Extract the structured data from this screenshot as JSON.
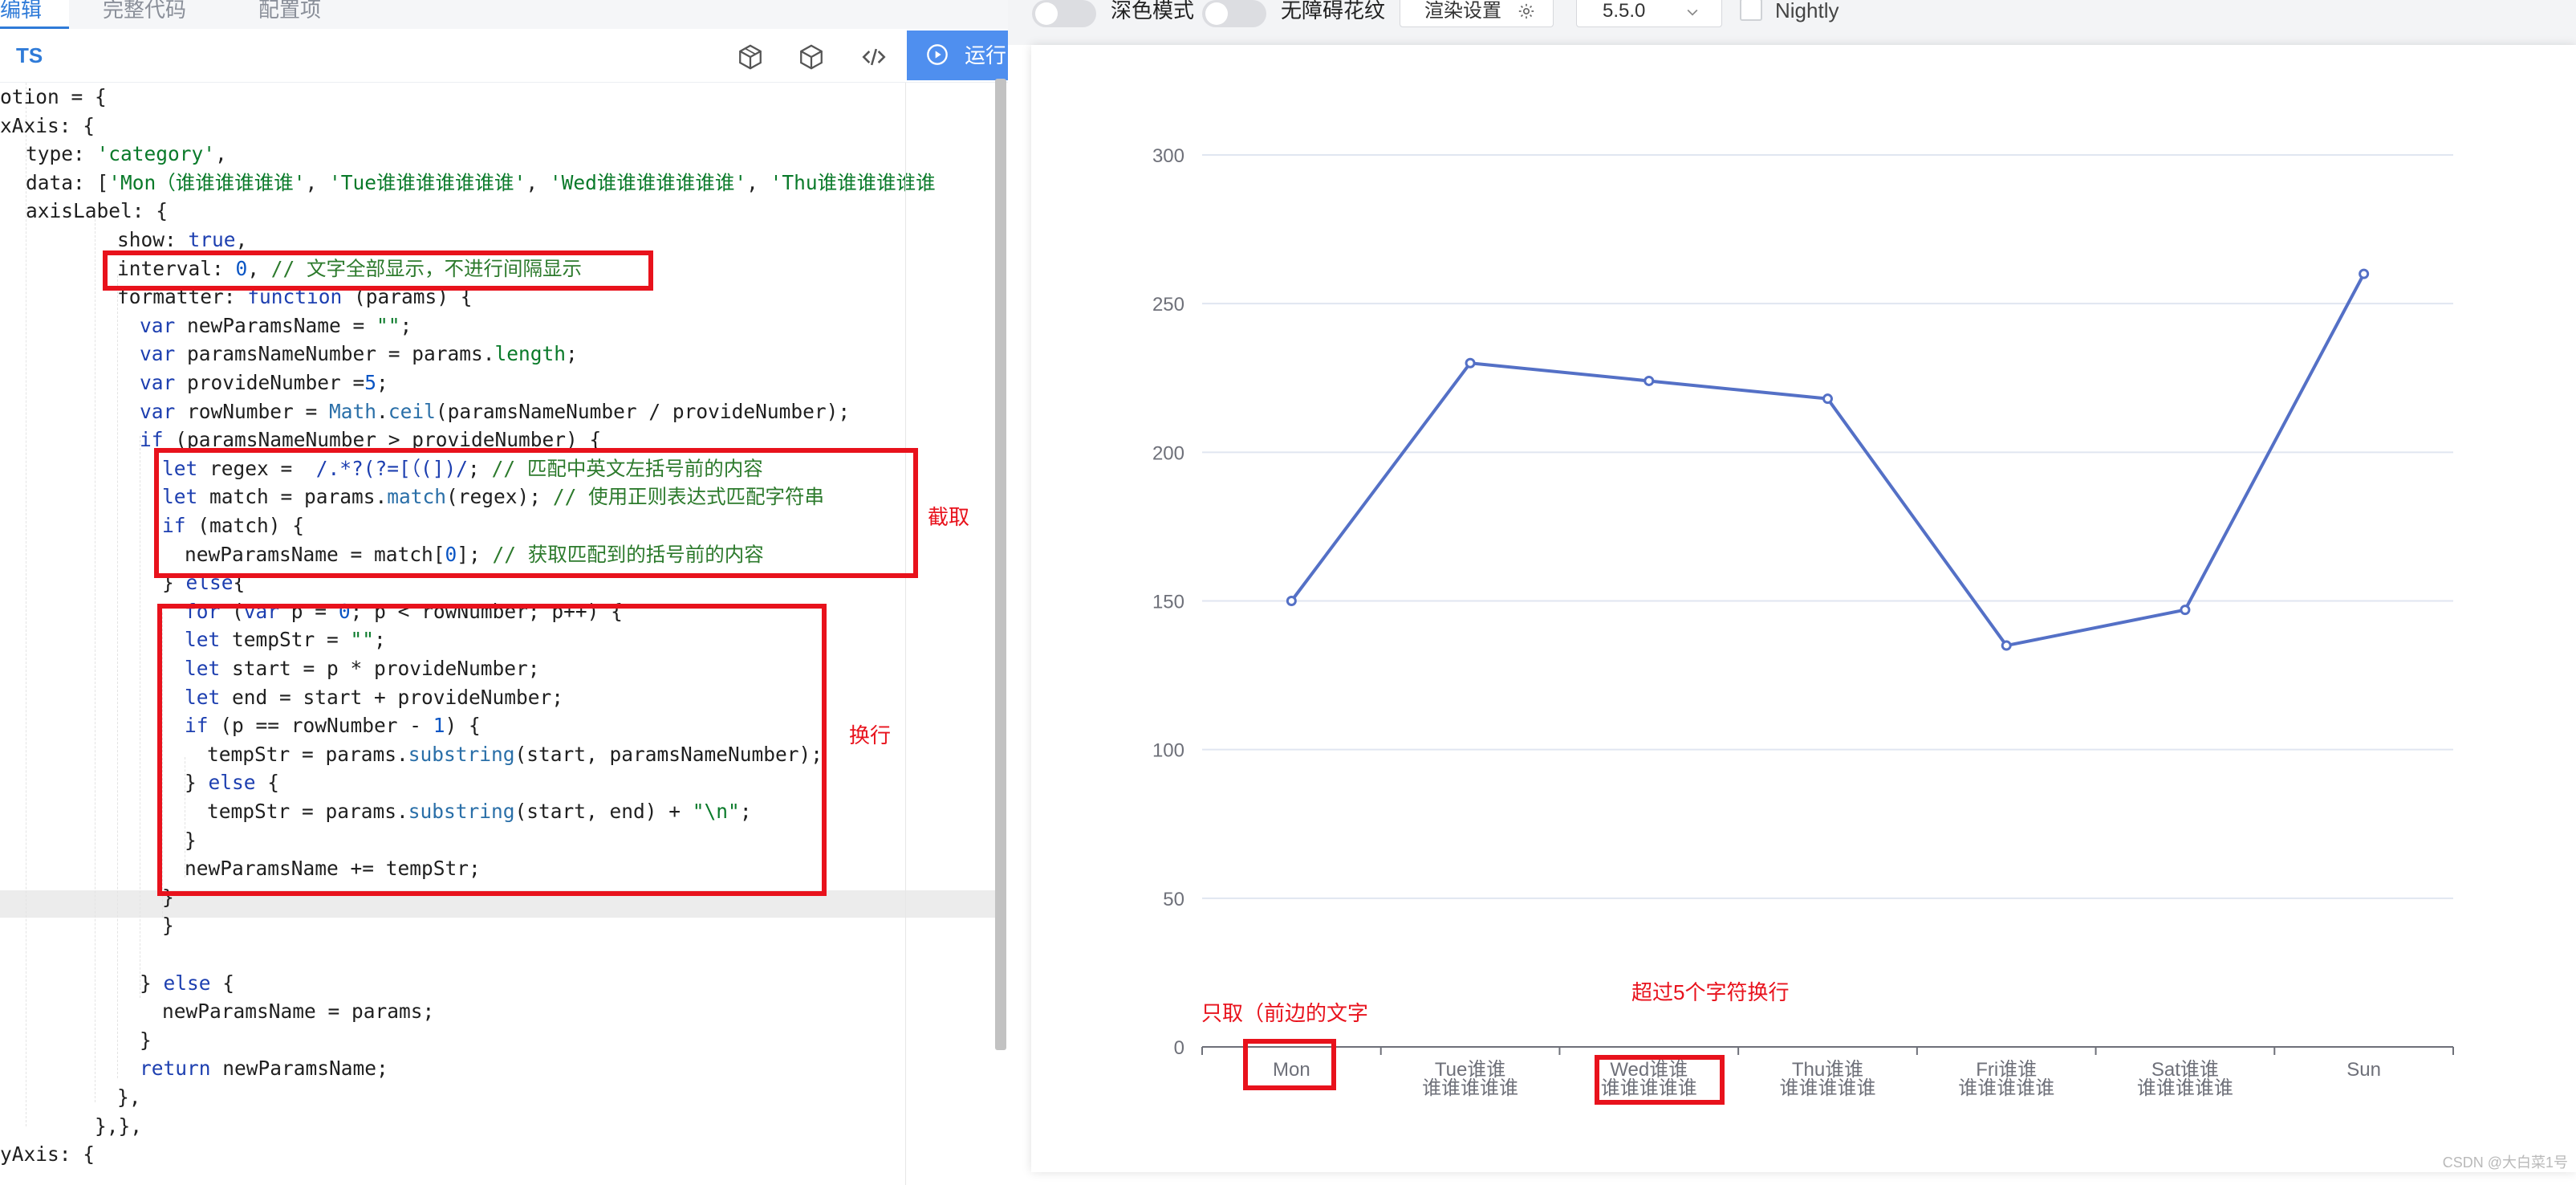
{
  "tabs": [
    {
      "label": "编辑",
      "active": true
    },
    {
      "label": "完整代码",
      "active": false
    },
    {
      "label": "配置项",
      "active": false
    }
  ],
  "toolbar": {
    "language": "TS",
    "icons": [
      "cube-outline-icon",
      "cube-icon",
      "code-icon"
    ],
    "run_label": "运行"
  },
  "code_lines": [
    {
      "indent": 0,
      "spans": [
        {
          "t": "otion = {",
          "c": ""
        }
      ]
    },
    {
      "indent": 0,
      "spans": [
        {
          "t": "xAxis: {",
          "c": ""
        }
      ]
    },
    {
      "indent": 32,
      "spans": [
        {
          "t": "type: ",
          "c": ""
        },
        {
          "t": "'category'",
          "c": "s"
        },
        {
          "t": ",",
          "c": ""
        }
      ]
    },
    {
      "indent": 32,
      "spans": [
        {
          "t": "data: [",
          "c": ""
        },
        {
          "t": "'Mon（谁谁谁谁谁谁'",
          "c": "s"
        },
        {
          "t": ", ",
          "c": ""
        },
        {
          "t": "'Tue谁谁谁谁谁谁谁'",
          "c": "s"
        },
        {
          "t": ", ",
          "c": ""
        },
        {
          "t": "'Wed谁谁谁谁谁谁谁'",
          "c": "s"
        },
        {
          "t": ", ",
          "c": ""
        },
        {
          "t": "'Thu谁谁谁谁谁谁",
          "c": "s"
        }
      ]
    },
    {
      "indent": 32,
      "spans": [
        {
          "t": "axisLabel: {",
          "c": ""
        }
      ]
    },
    {
      "indent": 146,
      "spans": [
        {
          "t": "show: ",
          "c": ""
        },
        {
          "t": "true",
          "c": "k"
        },
        {
          "t": ",",
          "c": ""
        }
      ]
    },
    {
      "indent": 146,
      "spans": [
        {
          "t": "interval: ",
          "c": ""
        },
        {
          "t": "0",
          "c": "n"
        },
        {
          "t": ", ",
          "c": ""
        },
        {
          "t": "// 文字全部显示，不进行间隔显示",
          "c": "c"
        }
      ]
    },
    {
      "indent": 146,
      "spans": [
        {
          "t": "formatter: ",
          "c": ""
        },
        {
          "t": "function",
          "c": "k"
        },
        {
          "t": " (params) {",
          "c": ""
        }
      ]
    },
    {
      "indent": 174,
      "spans": [
        {
          "t": "var",
          "c": "k"
        },
        {
          "t": " newParamsName = ",
          "c": ""
        },
        {
          "t": "\"\"",
          "c": "s"
        },
        {
          "t": ";",
          "c": ""
        }
      ]
    },
    {
      "indent": 174,
      "spans": [
        {
          "t": "var",
          "c": "k"
        },
        {
          "t": " paramsNameNumber = params.",
          "c": ""
        },
        {
          "t": "length",
          "c": "s"
        },
        {
          "t": ";",
          "c": ""
        }
      ]
    },
    {
      "indent": 174,
      "spans": [
        {
          "t": "var",
          "c": "k"
        },
        {
          "t": " provideNumber =",
          "c": ""
        },
        {
          "t": "5",
          "c": "n"
        },
        {
          "t": ";",
          "c": ""
        }
      ]
    },
    {
      "indent": 174,
      "spans": [
        {
          "t": "var",
          "c": "k"
        },
        {
          "t": " rowNumber = ",
          "c": ""
        },
        {
          "t": "Math",
          "c": "f"
        },
        {
          "t": ".",
          "c": ""
        },
        {
          "t": "ceil",
          "c": "f"
        },
        {
          "t": "(paramsNameNumber / provideNumber);",
          "c": ""
        }
      ]
    },
    {
      "indent": 174,
      "spans": [
        {
          "t": "if",
          "c": "k"
        },
        {
          "t": " (paramsNameNumber > provideNumber) {",
          "c": ""
        }
      ]
    },
    {
      "indent": 202,
      "spans": [
        {
          "t": "let",
          "c": "k"
        },
        {
          "t": " regex =  ",
          "c": ""
        },
        {
          "t": "/.*?(?=[（(])/",
          "c": "k"
        },
        {
          "t": "; ",
          "c": ""
        },
        {
          "t": "// 匹配中英文左括号前的内容",
          "c": "c"
        }
      ]
    },
    {
      "indent": 202,
      "spans": [
        {
          "t": "let",
          "c": "k"
        },
        {
          "t": " match = params.",
          "c": ""
        },
        {
          "t": "match",
          "c": "f"
        },
        {
          "t": "(regex); ",
          "c": ""
        },
        {
          "t": "// 使用正则表达式匹配字符串",
          "c": "c"
        }
      ]
    },
    {
      "indent": 202,
      "spans": [
        {
          "t": "if",
          "c": "k"
        },
        {
          "t": " (match) {",
          "c": ""
        }
      ]
    },
    {
      "indent": 230,
      "spans": [
        {
          "t": "newParamsName = match[",
          "c": ""
        },
        {
          "t": "0",
          "c": "n"
        },
        {
          "t": "]; ",
          "c": ""
        },
        {
          "t": "// 获取匹配到的括号前的内容",
          "c": "c"
        }
      ]
    },
    {
      "indent": 202,
      "spans": [
        {
          "t": "} ",
          "c": ""
        },
        {
          "t": "else",
          "c": "k"
        },
        {
          "t": "{",
          "c": ""
        }
      ]
    },
    {
      "indent": 230,
      "spans": [
        {
          "t": "for",
          "c": "k"
        },
        {
          "t": " (",
          "c": ""
        },
        {
          "t": "var",
          "c": "k"
        },
        {
          "t": " p = ",
          "c": ""
        },
        {
          "t": "0",
          "c": "n"
        },
        {
          "t": "; p < rowNumber; p++) {",
          "c": ""
        }
      ]
    },
    {
      "indent": 230,
      "spans": [
        {
          "t": "let",
          "c": "k"
        },
        {
          "t": " tempStr = ",
          "c": ""
        },
        {
          "t": "\"\"",
          "c": "s"
        },
        {
          "t": ";",
          "c": ""
        }
      ]
    },
    {
      "indent": 230,
      "spans": [
        {
          "t": "let",
          "c": "k"
        },
        {
          "t": " start = p * provideNumber;",
          "c": ""
        }
      ]
    },
    {
      "indent": 230,
      "spans": [
        {
          "t": "let",
          "c": "k"
        },
        {
          "t": " end = start + provideNumber;",
          "c": ""
        }
      ]
    },
    {
      "indent": 230,
      "spans": [
        {
          "t": "if",
          "c": "k"
        },
        {
          "t": " (p == rowNumber - ",
          "c": ""
        },
        {
          "t": "1",
          "c": "n"
        },
        {
          "t": ") {",
          "c": ""
        }
      ]
    },
    {
      "indent": 258,
      "spans": [
        {
          "t": "tempStr = params.",
          "c": ""
        },
        {
          "t": "substring",
          "c": "f"
        },
        {
          "t": "(start, paramsNameNumber);",
          "c": ""
        }
      ]
    },
    {
      "indent": 230,
      "spans": [
        {
          "t": "} ",
          "c": ""
        },
        {
          "t": "else",
          "c": "k"
        },
        {
          "t": " {",
          "c": ""
        }
      ]
    },
    {
      "indent": 258,
      "spans": [
        {
          "t": "tempStr = params.",
          "c": ""
        },
        {
          "t": "substring",
          "c": "f"
        },
        {
          "t": "(start, end) + ",
          "c": ""
        },
        {
          "t": "\"\\n\"",
          "c": "s"
        },
        {
          "t": ";",
          "c": ""
        }
      ]
    },
    {
      "indent": 230,
      "spans": [
        {
          "t": "}",
          "c": ""
        }
      ]
    },
    {
      "indent": 230,
      "spans": [
        {
          "t": "newParamsName += tempStr;",
          "c": ""
        }
      ]
    },
    {
      "indent": 202,
      "spans": [
        {
          "t": "}",
          "c": ""
        }
      ]
    },
    {
      "indent": 202,
      "spans": [
        {
          "t": "}",
          "c": ""
        }
      ]
    },
    {
      "indent": 0,
      "spans": [
        {
          "t": "",
          "c": ""
        }
      ]
    },
    {
      "indent": 174,
      "spans": [
        {
          "t": "} ",
          "c": ""
        },
        {
          "t": "else",
          "c": "k"
        },
        {
          "t": " {",
          "c": ""
        }
      ]
    },
    {
      "indent": 202,
      "spans": [
        {
          "t": "newParamsName = params;",
          "c": ""
        }
      ]
    },
    {
      "indent": 174,
      "spans": [
        {
          "t": "}",
          "c": ""
        }
      ]
    },
    {
      "indent": 174,
      "spans": [
        {
          "t": "return",
          "c": "k"
        },
        {
          "t": " newParamsName;",
          "c": ""
        }
      ]
    },
    {
      "indent": 146,
      "spans": [
        {
          "t": "},",
          "c": ""
        }
      ]
    },
    {
      "indent": 118,
      "spans": [
        {
          "t": "},},",
          "c": ""
        }
      ]
    },
    {
      "indent": 0,
      "spans": [
        {
          "t": "yAxis: {",
          "c": ""
        }
      ]
    }
  ],
  "annotations": {
    "extract_label": "截取",
    "wrap_label": "换行",
    "only_before_paren": "只取（前边的文字",
    "wrap_over_five": "超过5个字符换行"
  },
  "topbar": {
    "dark_mode_label": "深色模式",
    "no_pattern_label": "无障碍花纹",
    "render_settings_label": "渲染设置",
    "version_value": "5.5.0",
    "nightly_label": "Nightly"
  },
  "chart_data": {
    "type": "line",
    "categories": [
      [
        "Mon"
      ],
      [
        "Tue谁谁",
        "谁谁谁谁谁"
      ],
      [
        "Wed谁谁",
        "谁谁谁谁谁"
      ],
      [
        "Thu谁谁",
        "谁谁谁谁谁"
      ],
      [
        "Fri谁谁",
        "谁谁谁谁谁"
      ],
      [
        "Sat谁谁",
        "谁谁谁谁谁"
      ],
      [
        "Sun"
      ]
    ],
    "values": [
      150,
      230,
      224,
      218,
      135,
      147,
      260
    ],
    "yticks": [
      0,
      50,
      100,
      150,
      200,
      250,
      300
    ],
    "ylim": [
      0,
      300
    ],
    "line_color": "#5470c6",
    "grid": true
  },
  "watermark": "CSDN @大白菜1号"
}
